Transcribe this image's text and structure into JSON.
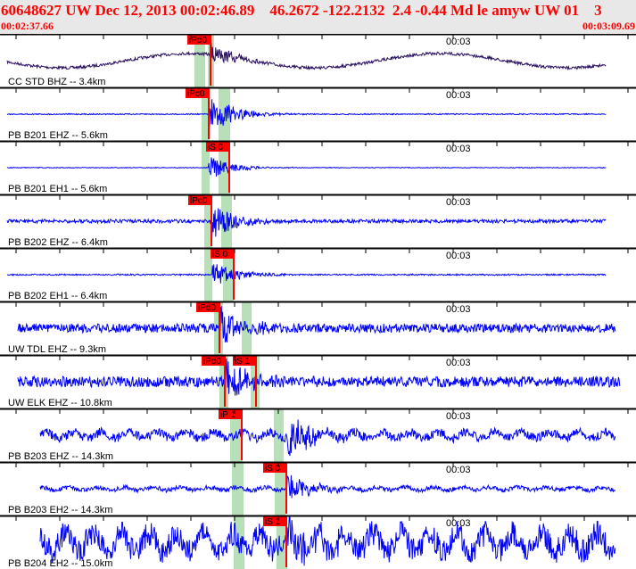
{
  "header": {
    "title": "60648627 UW Dec 12, 2013 00:02:46.89    46.2672 -122.2132  2.4 -0.44 Md le amyw UW 01    3",
    "start_time": "00:02:37.66",
    "end_time": "00:03:09.69"
  },
  "colors": {
    "trace": "#0000ff",
    "trace_first": "#2a1060",
    "pick": "#ff0000",
    "window": "#b8e0b8"
  },
  "tick_label": "00:03",
  "channels": [
    {
      "label": "CC STD BHZ -- 3.4km",
      "picks": [
        {
          "text": "iPd0",
          "at": 236
        }
      ],
      "windows": [
        [
          218,
          230
        ],
        [
          233,
          240
        ]
      ],
      "onset": 236,
      "amp": 0.5,
      "noise": 0.08
    },
    {
      "label": "PB B201 EHZ -- 5.6km",
      "picks": [
        {
          "text": "iPc0",
          "at": 234
        }
      ],
      "windows": [
        [
          226,
          235
        ],
        [
          245,
          258
        ]
      ],
      "onset": 234,
      "amp": 0.9,
      "noise": 0.03
    },
    {
      "label": "PB B201 EH1 -- 5.6km",
      "picks": [
        {
          "text": "iS 0",
          "at": 257
        }
      ],
      "windows": [
        [
          226,
          235
        ],
        [
          245,
          258
        ]
      ],
      "onset": 234,
      "amp": 0.5,
      "noise": 0.02
    },
    {
      "label": "PB B202 EHZ -- 6.4km",
      "picks": [
        {
          "text": "iPc0",
          "at": 237
        }
      ],
      "windows": [
        [
          229,
          238
        ],
        [
          248,
          260
        ]
      ],
      "onset": 237,
      "amp": 0.9,
      "noise": 0.1
    },
    {
      "label": "PB B202 EH1 -- 6.4km",
      "picks": [
        {
          "text": "iS 0",
          "at": 262
        }
      ],
      "windows": [
        [
          229,
          238
        ],
        [
          250,
          262
        ]
      ],
      "onset": 238,
      "amp": 0.6,
      "noise": 0.04
    },
    {
      "label": "UW TDL EHZ -- 9.3km",
      "picks": [
        {
          "text": "iPd0",
          "at": 246
        }
      ],
      "windows": [
        [
          240,
          250
        ],
        [
          271,
          282
        ]
      ],
      "onset": 246,
      "amp": 1,
      "noise": 0.25
    },
    {
      "label": "UW ELK EHZ -- 10.8km",
      "picks": [
        {
          "text": "iPd0",
          "at": 252
        },
        {
          "text": "iS 1",
          "at": 287
        }
      ],
      "windows": [
        [
          246,
          256
        ],
        [
          281,
          291
        ]
      ],
      "onset": 252,
      "amp": 1,
      "noise": 0.3
    },
    {
      "label": "PB B203 EHZ -- 14.3km",
      "picks": [
        {
          "text": "iP 1",
          "at": 271
        }
      ],
      "windows": [
        [
          258,
          272
        ],
        [
          307,
          318
        ]
      ],
      "onset": 322,
      "amp": 1,
      "noise": 0.25
    },
    {
      "label": "PB B203 EH2 -- 14.3km",
      "picks": [
        {
          "text": "iS 0",
          "at": 321
        }
      ],
      "windows": [
        [
          260,
          273
        ],
        [
          308,
          320
        ]
      ],
      "onset": 322,
      "amp": 0.6,
      "noise": 0.12
    },
    {
      "label": "PB B204 EH2 -- 15.0km",
      "picks": [
        {
          "text": "iS 1",
          "at": 321
        }
      ],
      "windows": [
        [
          262,
          274
        ],
        [
          310,
          322
        ]
      ],
      "onset": 322,
      "amp": 1,
      "noise": 0.7
    }
  ]
}
